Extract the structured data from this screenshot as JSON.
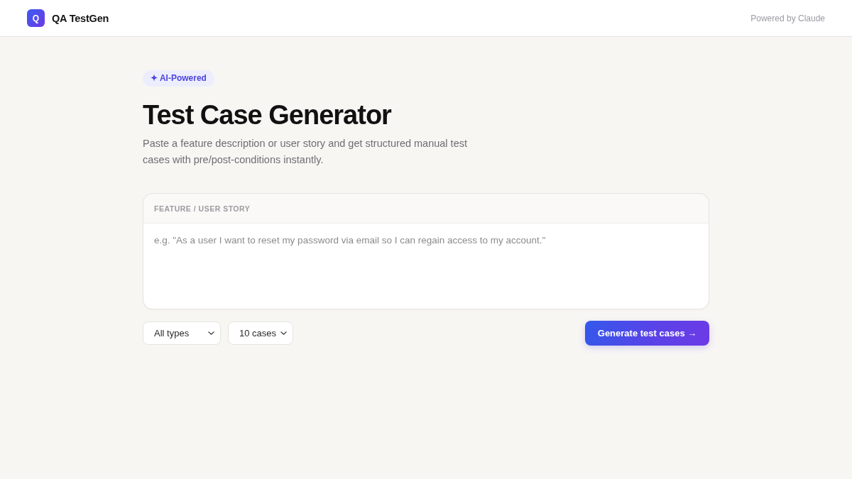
{
  "header": {
    "logo_letter": "Q",
    "app_name": "QA TestGen",
    "powered_by": "Powered by Claude"
  },
  "hero": {
    "badge": "✦ AI-Powered",
    "title": "Test Case Generator",
    "subtitle": "Paste a feature description or user story and get structured manual test cases with pre/post-conditions instantly."
  },
  "feature_input": {
    "label": "FEATURE / USER STORY",
    "placeholder": "e.g. \"As a user I want to reset my password via email so I can regain access to my account.\""
  },
  "filters": [
    {
      "kind": "select",
      "value": "All types"
    },
    {
      "kind": "select",
      "value": "10 cases"
    }
  ],
  "generate_button": {
    "label": "Generate test cases →"
  }
}
